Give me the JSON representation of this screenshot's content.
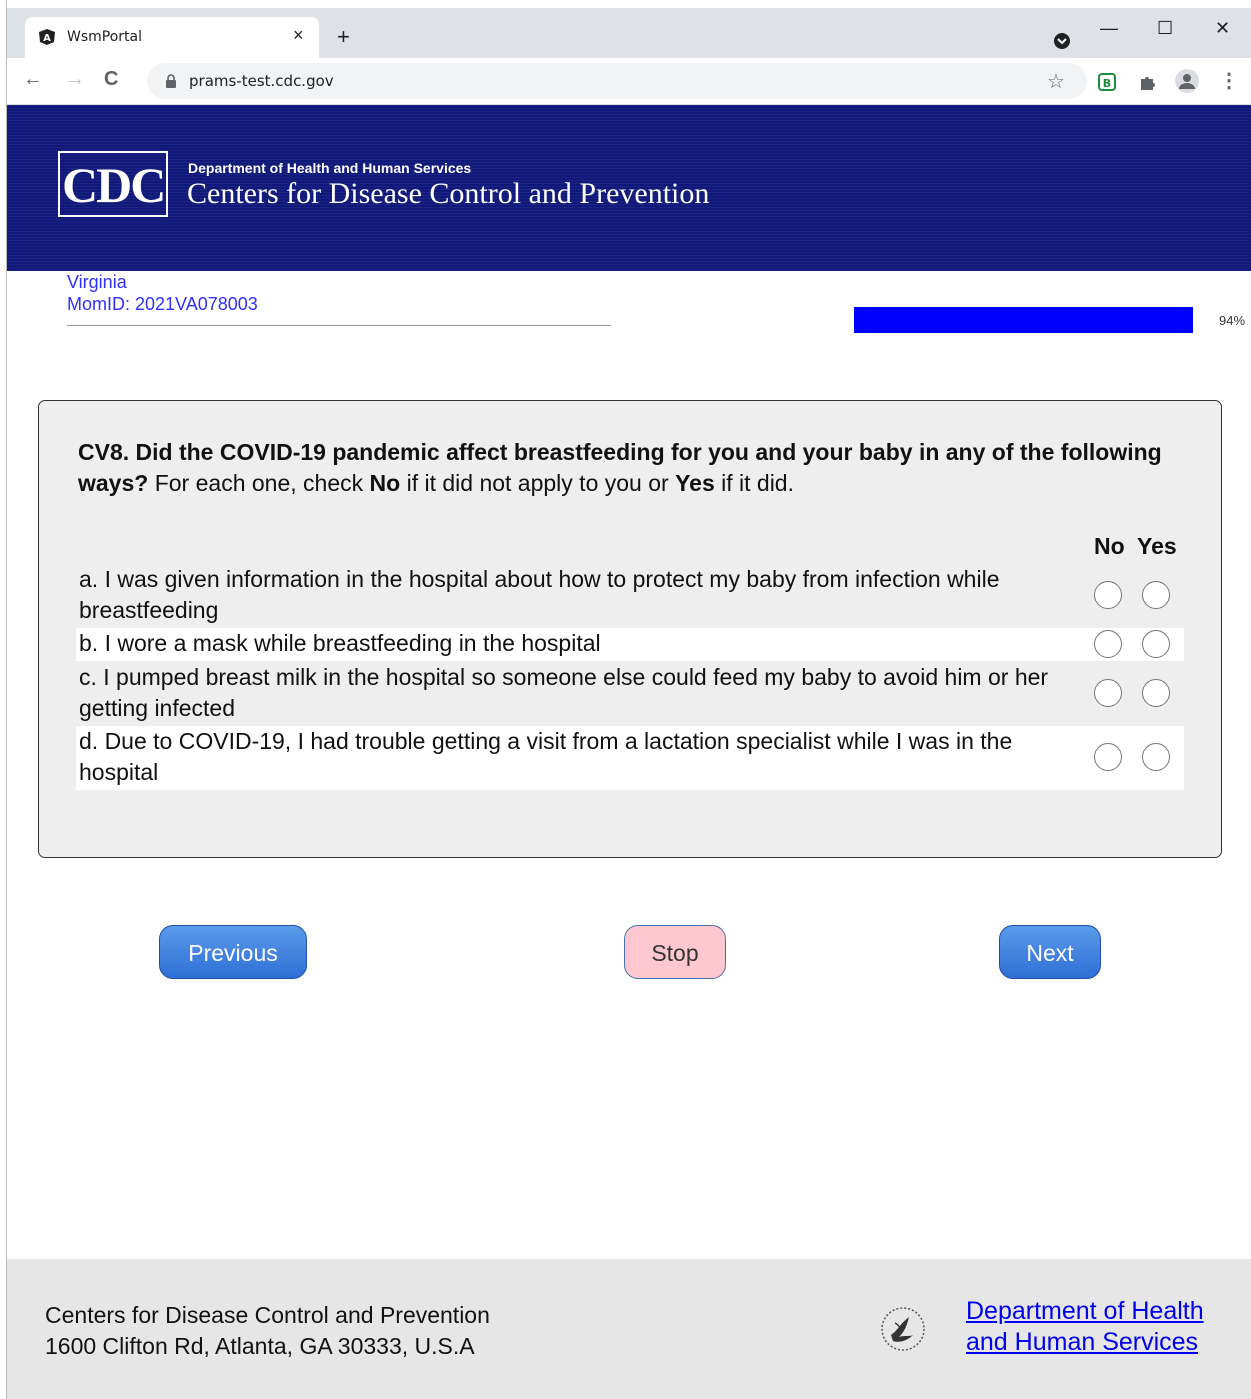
{
  "browser": {
    "tab_title": "WsmPortal",
    "tab_close": "×",
    "new_tab": "+",
    "minimize": "—",
    "maximize": "☐",
    "close": "✕",
    "back": "←",
    "forward": "→",
    "reload": "C",
    "url": "prams-test.cdc.gov",
    "bookmark": "☆",
    "menu": "⋮"
  },
  "header": {
    "logo_text": "CDC",
    "department": "Department of Health and Human Services",
    "agency": "Centers for Disease Control and Prevention"
  },
  "respondent": {
    "state": "Virginia",
    "mom_id": "MomID: 2021VA078003"
  },
  "progress": {
    "percent": 94,
    "label": "94%"
  },
  "question": {
    "id_bold": "CV8. Did the COVID-19 pandemic affect breastfeeding for you and your baby in any of the following ways?",
    "instr_1": " For each one, check ",
    "no_word": "No",
    "instr_2": " if it did not apply to you or ",
    "yes_word": "Yes",
    "instr_3": " if it did.",
    "col_no": "No",
    "col_yes": "Yes",
    "items": [
      {
        "label": "a. I was given information in the hospital about how to protect my baby from infection while breastfeeding"
      },
      {
        "label": "b. I wore a mask while breastfeeding in the hospital"
      },
      {
        "label": "c. I pumped breast milk in the hospital so someone else could feed my baby to avoid him or her getting infected"
      },
      {
        "label": "d. Due to COVID-19, I had trouble getting a visit from a lactation specialist while I was in the hospital"
      }
    ]
  },
  "nav": {
    "previous": "Previous",
    "stop": "Stop",
    "next": "Next"
  },
  "footer": {
    "org": "Centers for Disease Control and Prevention",
    "address": "1600 Clifton Rd, Atlanta, GA 30333, U.S.A",
    "hhs_link": "Department of Health and Human Services"
  },
  "colors": {
    "header_bg": "#10187a",
    "progress": "#0000ff",
    "link": "#3030ff",
    "button_blue": "#2f6fd6",
    "button_stop": "#ffc8d0"
  }
}
